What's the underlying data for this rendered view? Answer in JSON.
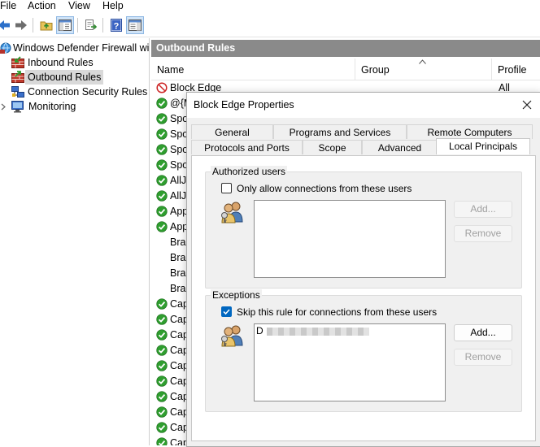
{
  "menu": {
    "file": "File",
    "action": "Action",
    "view": "View",
    "help": "Help"
  },
  "toolbar": {
    "buttons": [
      "back-arrow-icon",
      "forward-arrow-icon",
      "up-folder-icon",
      "show-hide-console-tree-icon",
      "export-list-icon",
      "help-icon",
      "show-hide-action-pane-icon"
    ]
  },
  "tree": {
    "root": "Windows Defender Firewall with",
    "inbound": "Inbound Rules",
    "outbound": "Outbound Rules",
    "connection_security": "Connection Security Rules",
    "monitoring": "Monitoring"
  },
  "pane": {
    "title": "Outbound Rules",
    "columns": {
      "name": "Name",
      "group": "Group",
      "profile": "Profile"
    },
    "rows": [
      {
        "name": "Block Edge",
        "profile": "All",
        "icon": "blocked"
      },
      {
        "name": "@{M",
        "icon": "allowed"
      },
      {
        "name": "Spo",
        "icon": "allowed"
      },
      {
        "name": "Spo",
        "icon": "allowed"
      },
      {
        "name": "Spo",
        "icon": "allowed"
      },
      {
        "name": "Spo",
        "icon": "allowed"
      },
      {
        "name": "AllJ",
        "icon": "allowed"
      },
      {
        "name": "AllJ",
        "icon": "allowed"
      },
      {
        "name": "App",
        "icon": "allowed"
      },
      {
        "name": "App",
        "icon": "allowed"
      },
      {
        "name": "Brar",
        "icon": "none"
      },
      {
        "name": "Brar",
        "icon": "none"
      },
      {
        "name": "Brar",
        "icon": "none"
      },
      {
        "name": "Brar",
        "icon": "none"
      },
      {
        "name": "Cap",
        "icon": "allowed"
      },
      {
        "name": "Cap",
        "icon": "allowed"
      },
      {
        "name": "Cap",
        "icon": "allowed"
      },
      {
        "name": "Cap",
        "icon": "allowed"
      },
      {
        "name": "Cap",
        "icon": "allowed"
      },
      {
        "name": "Cap",
        "icon": "allowed"
      },
      {
        "name": "Cap",
        "icon": "allowed"
      },
      {
        "name": "Cap",
        "icon": "allowed"
      },
      {
        "name": "Cap",
        "icon": "allowed"
      },
      {
        "name": "Cap",
        "icon": "allowed"
      }
    ]
  },
  "dialog": {
    "title": "Block Edge Properties",
    "tabs_row1": [
      "General",
      "Programs and Services",
      "Remote Computers"
    ],
    "tabs_row2": [
      "Protocols and Ports",
      "Scope",
      "Advanced",
      "Local Principals"
    ],
    "active_tab": "Local Principals",
    "authorized_users": {
      "label": "Authorized users",
      "checkbox_label": "Only allow connections from these users",
      "checked": false,
      "add_label": "Add...",
      "remove_label": "Remove"
    },
    "exceptions": {
      "label": "Exceptions",
      "checkbox_label": "Skip this rule for connections from these users",
      "checked": true,
      "add_label": "Add...",
      "remove_label": "Remove",
      "list_first_char": "D"
    }
  },
  "colors": {
    "pane_header": "#8a8a8a",
    "checkbox_checked": "#0067c0",
    "allowed_green": "#2f9e2f",
    "blocked_red": "#cc2222"
  }
}
